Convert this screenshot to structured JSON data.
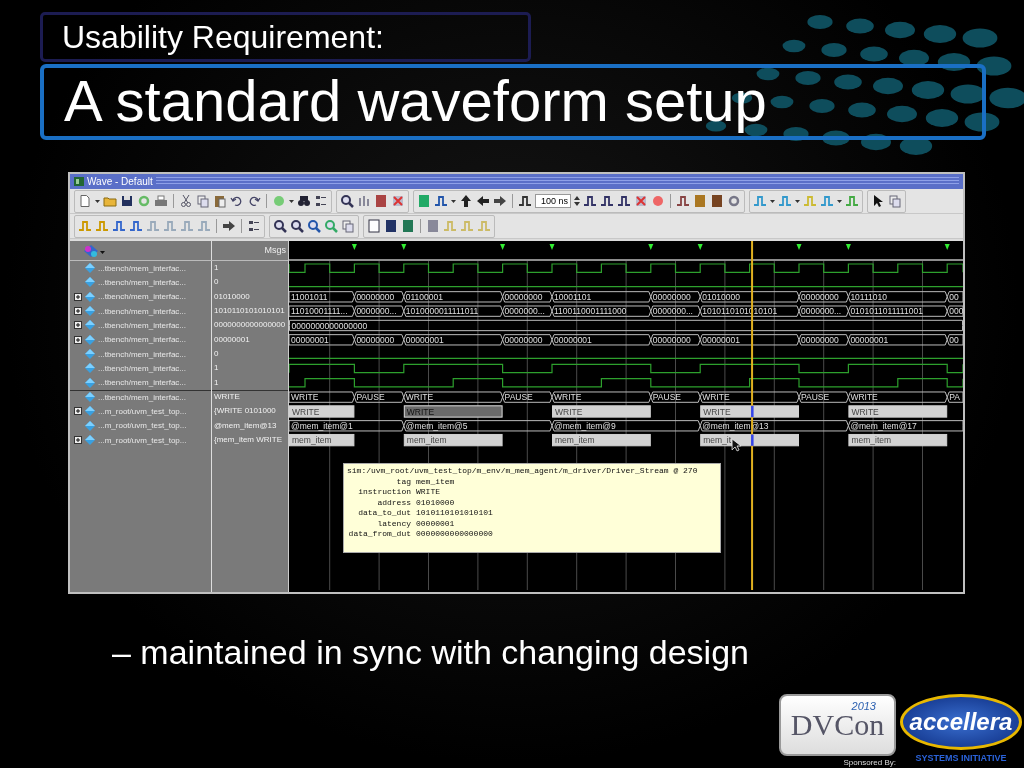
{
  "slide": {
    "subtitle": "Usability Requirement:",
    "title": "A standard waveform setup",
    "bullets": [
      {
        "text": "– maintained in sync with changing design",
        "kind": "sub"
      }
    ]
  },
  "window": {
    "title": "Wave - Default",
    "time_field": {
      "value": "100 ns"
    },
    "header": {
      "value_column": "Msgs"
    },
    "signals": [
      {
        "name": "...tbench/mem_interfac...",
        "value": "1",
        "expandable": false,
        "wave": {
          "kind": "clock"
        }
      },
      {
        "name": "...tbench/mem_interfac...",
        "value": "0",
        "expandable": false,
        "wave": {
          "kind": "low"
        }
      },
      {
        "name": "...tbench/mem_interfac...",
        "value": "01010000",
        "expandable": true,
        "wave": {
          "kind": "bus",
          "segments": [
            "11001011",
            "00000000",
            "01100001",
            "00000000",
            "10001101",
            "00000000",
            "01010000",
            "00000000",
            "10111010",
            "00"
          ]
        }
      },
      {
        "name": "...tbench/mem_interfac...",
        "value": "1010110101010101",
        "expandable": true,
        "wave": {
          "kind": "bus",
          "segments": [
            "11010001111...",
            "0000000...",
            "1010000011111011",
            "0000000...",
            "1100110001111000",
            "0000000...",
            "1010110101010101",
            "0000000...",
            "0101011011111001",
            "000"
          ]
        }
      },
      {
        "name": "...tbench/mem_interfac...",
        "value": "0000000000000000",
        "expandable": true,
        "wave": {
          "kind": "bus",
          "segments": [
            "0000000000000000"
          ]
        }
      },
      {
        "name": "...tbench/mem_interfac...",
        "value": "00000001",
        "expandable": true,
        "wave": {
          "kind": "bus",
          "segments": [
            "00000001",
            "00000000",
            "00000001",
            "00000000",
            "00000001",
            "00000000",
            "00000001",
            "00000000",
            "00000001",
            "00"
          ]
        }
      },
      {
        "name": "...tbench/mem_interfac...",
        "value": "0",
        "expandable": false,
        "wave": {
          "kind": "low"
        }
      },
      {
        "name": "...tbench/mem_interfac...",
        "value": "1",
        "expandable": false,
        "wave": {
          "kind": "gated"
        }
      },
      {
        "name": "...tbench/mem_interfac...",
        "value": "1",
        "expandable": false,
        "wave": {
          "kind": "strobe"
        }
      },
      {
        "name": "...tbench/mem_interfac...",
        "value": "WRITE",
        "expandable": false,
        "wave": {
          "kind": "bus",
          "segments": [
            "WRITE",
            "PAUSE",
            "WRITE",
            "PAUSE",
            "WRITE",
            "PAUSE",
            "WRITE",
            "PAUSE",
            "WRITE",
            "PA"
          ]
        }
      },
      {
        "name": "...m_root/uvm_test_top...",
        "value": "{WRITE 0101000",
        "expandable": true,
        "wave": {
          "kind": "transaction",
          "items": [
            {
              "text": "WRITE",
              "selected": false
            },
            {
              "text": "WRITE",
              "selected": true
            },
            {
              "text": "WRITE",
              "selected": false
            },
            {
              "text": "WRITE",
              "selected": false
            },
            {
              "text": "WRITE",
              "selected": false
            }
          ]
        }
      },
      {
        "name": "...m_root/uvm_test_top...",
        "value": "@mem_item@13",
        "expandable": false,
        "wave": {
          "kind": "stream",
          "segments": [
            "@mem_item@1",
            "@mem_item@5",
            "@mem_item@9",
            "@mem_item@13",
            "@mem_item@17"
          ]
        }
      },
      {
        "name": "...m_root/uvm_test_top...",
        "value": "{mem_item WRITE",
        "expandable": true,
        "wave": {
          "kind": "transaction",
          "items": [
            {
              "text": "mem_item",
              "selected": false
            },
            {
              "text": "mem_item",
              "selected": false
            },
            {
              "text": "mem_item",
              "selected": false
            },
            {
              "text": "mem_it",
              "selected": false
            },
            {
              "text": "mem_item",
              "selected": false
            }
          ]
        }
      }
    ],
    "tooltip": {
      "title": "sim:/uvm_root/uvm_test_top/m_env/m_mem_agent/m_driver/Driver_Stream @ 270",
      "fields": [
        {
          "label": "tag",
          "value": "mem_item"
        },
        {
          "label": "instruction",
          "value": "WRITE"
        },
        {
          "label": "address",
          "value": "01010000"
        },
        {
          "label": "data_to_dut",
          "value": "1010110101010101"
        },
        {
          "label": "latency",
          "value": "00000001"
        },
        {
          "label": "data_from_dut",
          "value": "0000000000000000"
        }
      ]
    }
  },
  "footer": {
    "sponsored": "Sponsored By:",
    "dvcon": {
      "name": "DVCon",
      "year": "2013"
    },
    "accellera": {
      "name": "accellera",
      "tagline": "SYSTEMS INITIATIVE"
    }
  }
}
